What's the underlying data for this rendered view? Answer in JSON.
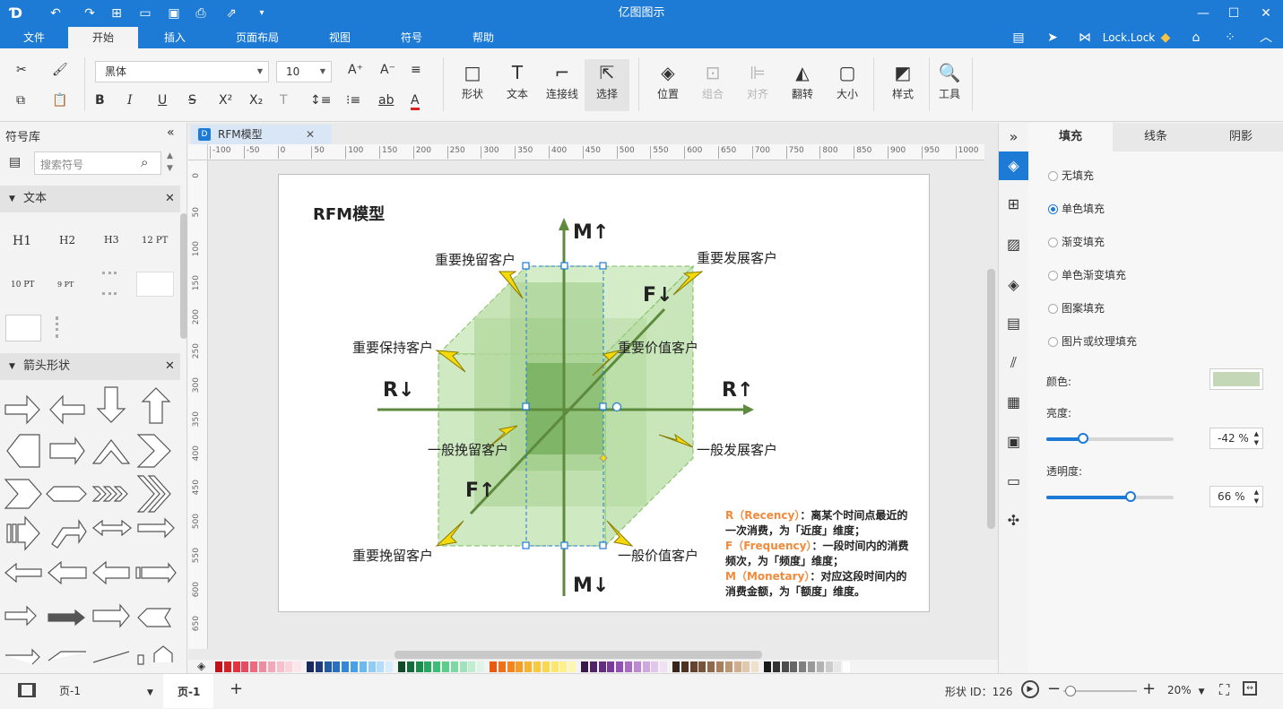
{
  "app": {
    "title": "亿图图示"
  },
  "titlebar": {
    "user": "Lock.Lock"
  },
  "menu": [
    "文件",
    "开始",
    "插入",
    "页面布局",
    "视图",
    "符号",
    "帮助"
  ],
  "ribbon": {
    "font_name": "黑体",
    "font_size": "10",
    "shape_label": "形状",
    "text_label": "文本",
    "connector_label": "连接线",
    "select_label": "选择",
    "position_label": "位置",
    "group_label": "组合",
    "align_label": "对齐",
    "flip_label": "翻转",
    "size_label": "大小",
    "style_label": "样式",
    "tools_label": "工具"
  },
  "left": {
    "panel_title": "符号库",
    "search_placeholder": "搜索符号",
    "sec_text": "文本",
    "sec_arrows": "箭头形状",
    "text_items": [
      "H1",
      "H2",
      "H3",
      "12 PT",
      "10 PT",
      "9 PT"
    ]
  },
  "doc": {
    "tab": "RFM模型"
  },
  "ruler_h": [
    "-100",
    "-50",
    "0",
    "50",
    "100",
    "150",
    "200",
    "250",
    "300",
    "350",
    "400",
    "450",
    "500",
    "550",
    "600",
    "650",
    "700",
    "750",
    "800",
    "850",
    "900",
    "950",
    "1000"
  ],
  "ruler_v": [
    "0",
    "50",
    "100",
    "150",
    "200",
    "250",
    "300",
    "350",
    "400",
    "450",
    "500",
    "550",
    "600",
    "650"
  ],
  "diagram": {
    "title": "RFM模型",
    "m_up": "M↑",
    "m_down": "M↓",
    "r_left": "R↓",
    "r_right": "R↑",
    "f_up": "F↑",
    "f_down": "F↓",
    "labels": {
      "tl": "重要挽留客户",
      "tr": "重要发展客户",
      "ml": "重要保持客户",
      "mc": "重要价值客户",
      "cl": "一般挽留客户",
      "cr": "一般发展客户",
      "bl": "重要挽留客户",
      "br": "一般价值客户"
    },
    "legend": {
      "r_key": "R（Recency）",
      "r_text": "：离某个时间点最近的一次消费，为「近度」维度；",
      "f_key": "F（Frequency）",
      "f_text": "：一段时间内的消费频次，为「频度」维度；",
      "m_key": "M（Monetary）",
      "m_text": "：对应这段时间内的消费金额，为「额度」维度。"
    }
  },
  "props": {
    "tabs": [
      "填充",
      "线条",
      "阴影"
    ],
    "fill_options": [
      "无填充",
      "单色填充",
      "渐变填充",
      "单色渐变填充",
      "图案填充",
      "图片或纹理填充"
    ],
    "selected_fill": 1,
    "color_label": "颜色:",
    "color_value": "#c4d8b8",
    "brightness_label": "亮度:",
    "brightness_value": "-42 %",
    "brightness_level": 0.29,
    "opacity_label": "透明度:",
    "opacity_value": "66 %",
    "opacity_level": 0.66
  },
  "status": {
    "page_select": "页-1",
    "page_tab": "页-1",
    "shape_id": "形状 ID：126",
    "zoom": "20%"
  },
  "colors": {
    "accent": "#1d7ad5",
    "cube": "#7dbd5e",
    "arrow": "#f5d90a",
    "legend_key": "#f08a3c"
  }
}
